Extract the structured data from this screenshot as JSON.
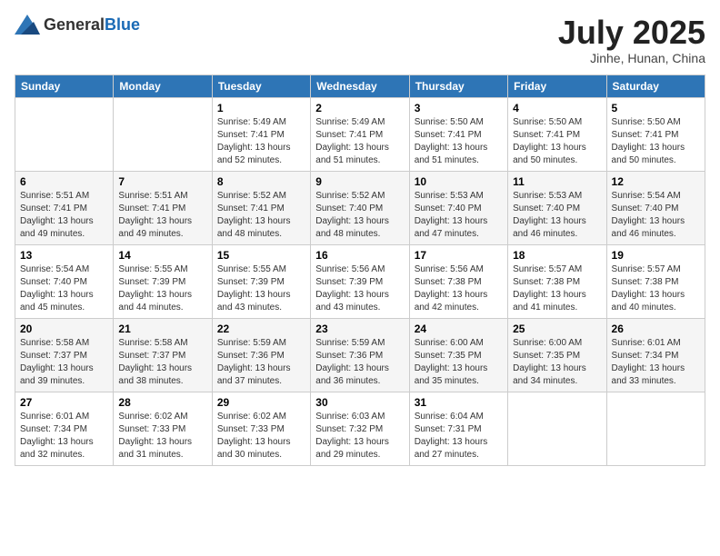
{
  "header": {
    "logo_general": "General",
    "logo_blue": "Blue",
    "month_title": "July 2025",
    "location": "Jinhe, Hunan, China"
  },
  "weekdays": [
    "Sunday",
    "Monday",
    "Tuesday",
    "Wednesday",
    "Thursday",
    "Friday",
    "Saturday"
  ],
  "weeks": [
    [
      {
        "day": "",
        "content": ""
      },
      {
        "day": "",
        "content": ""
      },
      {
        "day": "1",
        "content": "Sunrise: 5:49 AM\nSunset: 7:41 PM\nDaylight: 13 hours\nand 52 minutes."
      },
      {
        "day": "2",
        "content": "Sunrise: 5:49 AM\nSunset: 7:41 PM\nDaylight: 13 hours\nand 51 minutes."
      },
      {
        "day": "3",
        "content": "Sunrise: 5:50 AM\nSunset: 7:41 PM\nDaylight: 13 hours\nand 51 minutes."
      },
      {
        "day": "4",
        "content": "Sunrise: 5:50 AM\nSunset: 7:41 PM\nDaylight: 13 hours\nand 50 minutes."
      },
      {
        "day": "5",
        "content": "Sunrise: 5:50 AM\nSunset: 7:41 PM\nDaylight: 13 hours\nand 50 minutes."
      }
    ],
    [
      {
        "day": "6",
        "content": "Sunrise: 5:51 AM\nSunset: 7:41 PM\nDaylight: 13 hours\nand 49 minutes."
      },
      {
        "day": "7",
        "content": "Sunrise: 5:51 AM\nSunset: 7:41 PM\nDaylight: 13 hours\nand 49 minutes."
      },
      {
        "day": "8",
        "content": "Sunrise: 5:52 AM\nSunset: 7:41 PM\nDaylight: 13 hours\nand 48 minutes."
      },
      {
        "day": "9",
        "content": "Sunrise: 5:52 AM\nSunset: 7:40 PM\nDaylight: 13 hours\nand 48 minutes."
      },
      {
        "day": "10",
        "content": "Sunrise: 5:53 AM\nSunset: 7:40 PM\nDaylight: 13 hours\nand 47 minutes."
      },
      {
        "day": "11",
        "content": "Sunrise: 5:53 AM\nSunset: 7:40 PM\nDaylight: 13 hours\nand 46 minutes."
      },
      {
        "day": "12",
        "content": "Sunrise: 5:54 AM\nSunset: 7:40 PM\nDaylight: 13 hours\nand 46 minutes."
      }
    ],
    [
      {
        "day": "13",
        "content": "Sunrise: 5:54 AM\nSunset: 7:40 PM\nDaylight: 13 hours\nand 45 minutes."
      },
      {
        "day": "14",
        "content": "Sunrise: 5:55 AM\nSunset: 7:39 PM\nDaylight: 13 hours\nand 44 minutes."
      },
      {
        "day": "15",
        "content": "Sunrise: 5:55 AM\nSunset: 7:39 PM\nDaylight: 13 hours\nand 43 minutes."
      },
      {
        "day": "16",
        "content": "Sunrise: 5:56 AM\nSunset: 7:39 PM\nDaylight: 13 hours\nand 43 minutes."
      },
      {
        "day": "17",
        "content": "Sunrise: 5:56 AM\nSunset: 7:38 PM\nDaylight: 13 hours\nand 42 minutes."
      },
      {
        "day": "18",
        "content": "Sunrise: 5:57 AM\nSunset: 7:38 PM\nDaylight: 13 hours\nand 41 minutes."
      },
      {
        "day": "19",
        "content": "Sunrise: 5:57 AM\nSunset: 7:38 PM\nDaylight: 13 hours\nand 40 minutes."
      }
    ],
    [
      {
        "day": "20",
        "content": "Sunrise: 5:58 AM\nSunset: 7:37 PM\nDaylight: 13 hours\nand 39 minutes."
      },
      {
        "day": "21",
        "content": "Sunrise: 5:58 AM\nSunset: 7:37 PM\nDaylight: 13 hours\nand 38 minutes."
      },
      {
        "day": "22",
        "content": "Sunrise: 5:59 AM\nSunset: 7:36 PM\nDaylight: 13 hours\nand 37 minutes."
      },
      {
        "day": "23",
        "content": "Sunrise: 5:59 AM\nSunset: 7:36 PM\nDaylight: 13 hours\nand 36 minutes."
      },
      {
        "day": "24",
        "content": "Sunrise: 6:00 AM\nSunset: 7:35 PM\nDaylight: 13 hours\nand 35 minutes."
      },
      {
        "day": "25",
        "content": "Sunrise: 6:00 AM\nSunset: 7:35 PM\nDaylight: 13 hours\nand 34 minutes."
      },
      {
        "day": "26",
        "content": "Sunrise: 6:01 AM\nSunset: 7:34 PM\nDaylight: 13 hours\nand 33 minutes."
      }
    ],
    [
      {
        "day": "27",
        "content": "Sunrise: 6:01 AM\nSunset: 7:34 PM\nDaylight: 13 hours\nand 32 minutes."
      },
      {
        "day": "28",
        "content": "Sunrise: 6:02 AM\nSunset: 7:33 PM\nDaylight: 13 hours\nand 31 minutes."
      },
      {
        "day": "29",
        "content": "Sunrise: 6:02 AM\nSunset: 7:33 PM\nDaylight: 13 hours\nand 30 minutes."
      },
      {
        "day": "30",
        "content": "Sunrise: 6:03 AM\nSunset: 7:32 PM\nDaylight: 13 hours\nand 29 minutes."
      },
      {
        "day": "31",
        "content": "Sunrise: 6:04 AM\nSunset: 7:31 PM\nDaylight: 13 hours\nand 27 minutes."
      },
      {
        "day": "",
        "content": ""
      },
      {
        "day": "",
        "content": ""
      }
    ]
  ]
}
